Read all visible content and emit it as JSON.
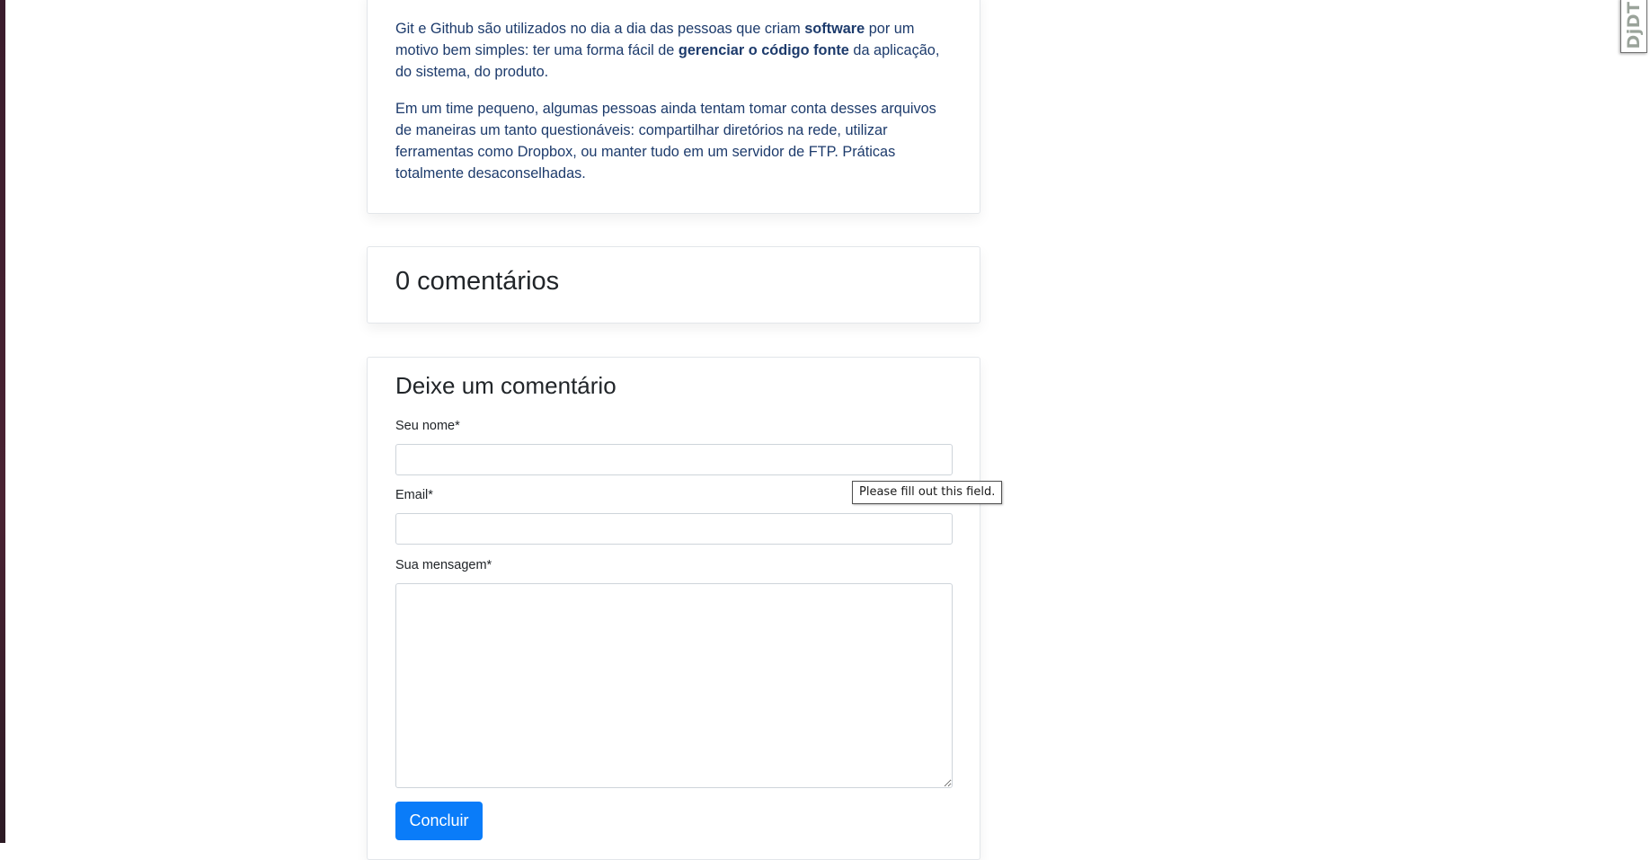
{
  "article": {
    "p1": {
      "t1": "Git e Github são utilizados no dia a dia das pessoas que criam ",
      "b1": "software",
      "t2": " por um motivo bem simples: ter uma forma fácil de ",
      "b2": "gerenciar o código fonte",
      "t3": " da aplicação, do sistema, do produto."
    },
    "p2": "Em um time pequeno, algumas pessoas ainda tentam tomar conta desses arquivos de maneiras um tanto questionáveis: compartilhar diretórios na rede, utilizar ferramentas como Dropbox, ou manter tudo em um servidor de FTP. Práticas totalmente desaconselhadas."
  },
  "comments": {
    "count_label": "0 comentários"
  },
  "form": {
    "title": "Deixe um comentário",
    "name_label": "Seu nome*",
    "name_value": "",
    "email_label": "Email*",
    "email_value": "",
    "message_label": "Sua mensagem*",
    "message_value": "",
    "submit_label": "Concluir"
  },
  "tooltip": {
    "text": "Please fill out this field."
  },
  "debug_toolbar": {
    "label": "DjDT"
  },
  "colors": {
    "article_text": "#1d3b6c",
    "button": "#0a7cf9",
    "border": "#e3e6ea"
  }
}
